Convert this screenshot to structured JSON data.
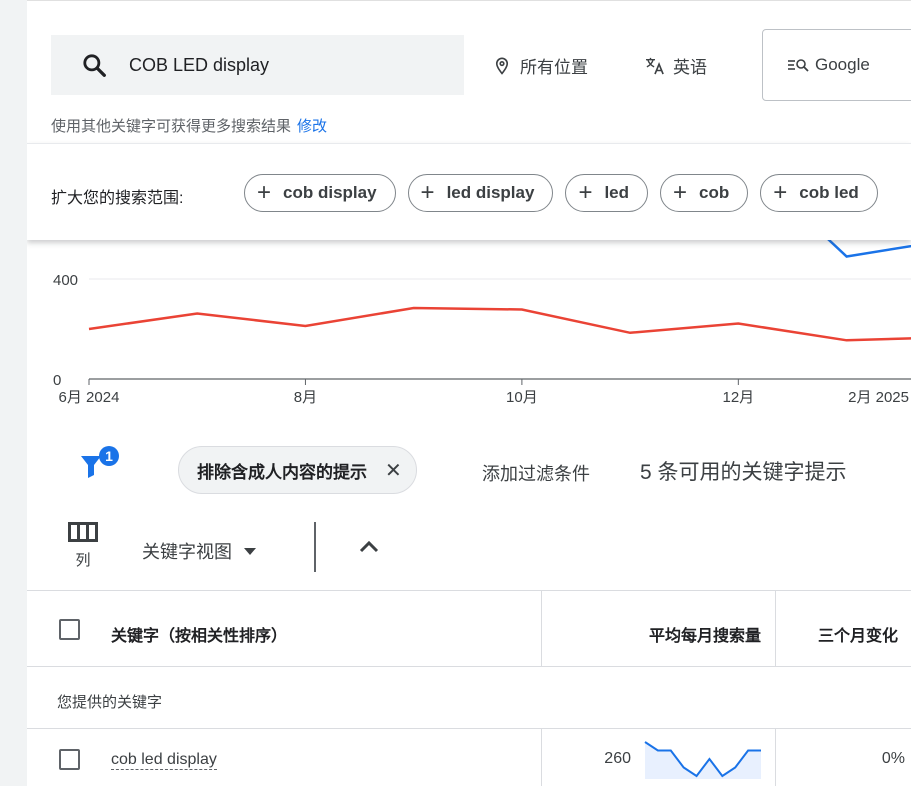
{
  "search": {
    "value": "COB LED display",
    "location": "所有位置",
    "language": "英语",
    "engine": "Google"
  },
  "hint": {
    "text": "使用其他关键字可获得更多搜索结果",
    "edit_link": "修改"
  },
  "broaden": {
    "label": "扩大您的搜索范围:",
    "chips": [
      "cob display",
      "led display",
      "led",
      "cob",
      "cob led"
    ]
  },
  "chart_data": {
    "type": "line",
    "x": [
      "2024-06",
      "2024-07",
      "2024-08",
      "2024-09",
      "2024-10",
      "2024-11",
      "2024-12",
      "2025-01",
      "2025-02",
      "2025-03"
    ],
    "tick_labels": [
      "6月 2024",
      "8月",
      "10月",
      "12月",
      "2月 2025"
    ],
    "y_ticks": [
      "0",
      "400"
    ],
    "ylim": [
      0,
      560
    ],
    "series": [
      {
        "color": "#ea4335",
        "values": [
          200,
          262,
          212,
          284,
          278,
          185,
          222,
          155,
          168,
          180
        ]
      },
      {
        "color": "#1a73e8",
        "values": [
          null,
          null,
          null,
          null,
          null,
          null,
          null,
          490,
          560,
          null
        ]
      }
    ],
    "grid": true
  },
  "filters": {
    "badge_count": "1",
    "exclude_chip": "排除含成人内容的提示",
    "add_filter": "添加过滤条件",
    "result_count": "5 条可用的关键字提示"
  },
  "toolbar": {
    "columns_label": "列",
    "view_label": "关键字视图"
  },
  "table": {
    "headers": {
      "keyword": "关键字（按相关性排序）",
      "avg_monthly": "平均每月搜索量",
      "three_month": "三个月变化"
    },
    "section_label": "您提供的关键字",
    "rows": [
      {
        "keyword": "cob led display",
        "avg": "260",
        "change": "0%",
        "trend": [
          5,
          4,
          4,
          2,
          1,
          3,
          1,
          2,
          4,
          4
        ]
      }
    ]
  },
  "colors": {
    "accent": "#1a73e8",
    "red_series": "#ea4335",
    "background": "#f1f3f4"
  }
}
